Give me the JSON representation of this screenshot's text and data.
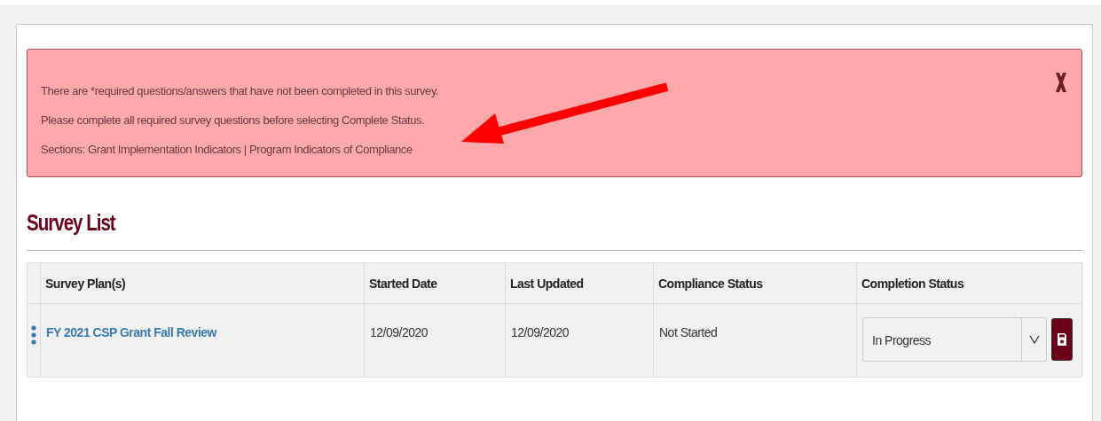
{
  "alert": {
    "lines": [
      "There are *required questions/answers that have not been completed in this survey.",
      "Please complete all required survey questions before selecting Complete Status.",
      "Sections: Grant Implementation Indicators | Program Indicators of Compliance"
    ]
  },
  "section_title": "Survey List",
  "table": {
    "columns": [
      "Survey Plan(s)",
      "Started Date",
      "Last Updated",
      "Compliance Status",
      "Completion Status"
    ],
    "rows": [
      {
        "survey_plan": "FY 2021 CSP Grant Fall Review",
        "started_date": "12/09/2020",
        "last_updated": "12/09/2020",
        "compliance_status": "Not Started",
        "completion_status": "In Progress"
      }
    ]
  }
}
